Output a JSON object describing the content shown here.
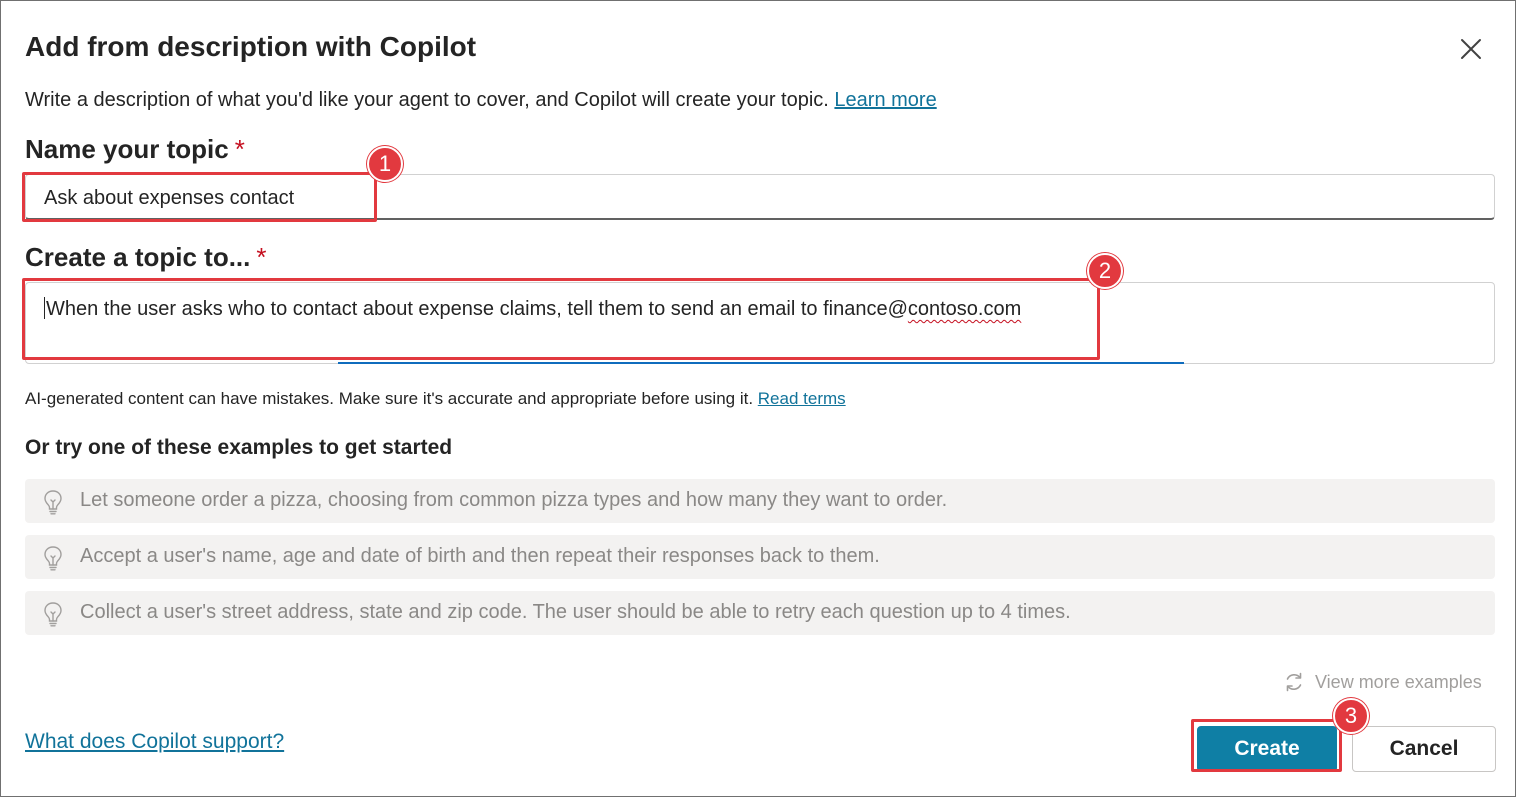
{
  "dialog": {
    "title": "Add from description with Copilot",
    "description": "Write a description of what you'd like your agent to cover, and Copilot will create your topic.",
    "learn_more": "Learn more"
  },
  "name_field": {
    "label": "Name your topic",
    "required_mark": "*",
    "value": "Ask about expenses contact"
  },
  "topic_field": {
    "label": "Create a topic to...",
    "required_mark": "*",
    "value_prefix": "When the user asks who to contact about expense claims, tell them to send an email to finance@",
    "value_misspelled": "contoso.com"
  },
  "disclaimer": {
    "text": "AI-generated content can have mistakes. Make sure it's accurate and appropriate before using it.",
    "link": "Read terms"
  },
  "examples": {
    "heading": "Or try one of these examples to get started",
    "items": [
      "Let someone order a pizza, choosing from common pizza types and how many they want to order.",
      "Accept a user's name, age and date of birth and then repeat their responses back to them.",
      "Collect a user's street address, state and zip code. The user should be able to retry each question up to 4 times."
    ],
    "more": "View more examples"
  },
  "footer": {
    "support_link": "What does Copilot support?",
    "create": "Create",
    "cancel": "Cancel"
  },
  "annotations": {
    "badges": [
      "1",
      "2",
      "3"
    ],
    "color": "#e2393f"
  },
  "colors": {
    "primary_button": "#0f7fa5",
    "link": "#11739a",
    "required": "#c50f1f"
  }
}
